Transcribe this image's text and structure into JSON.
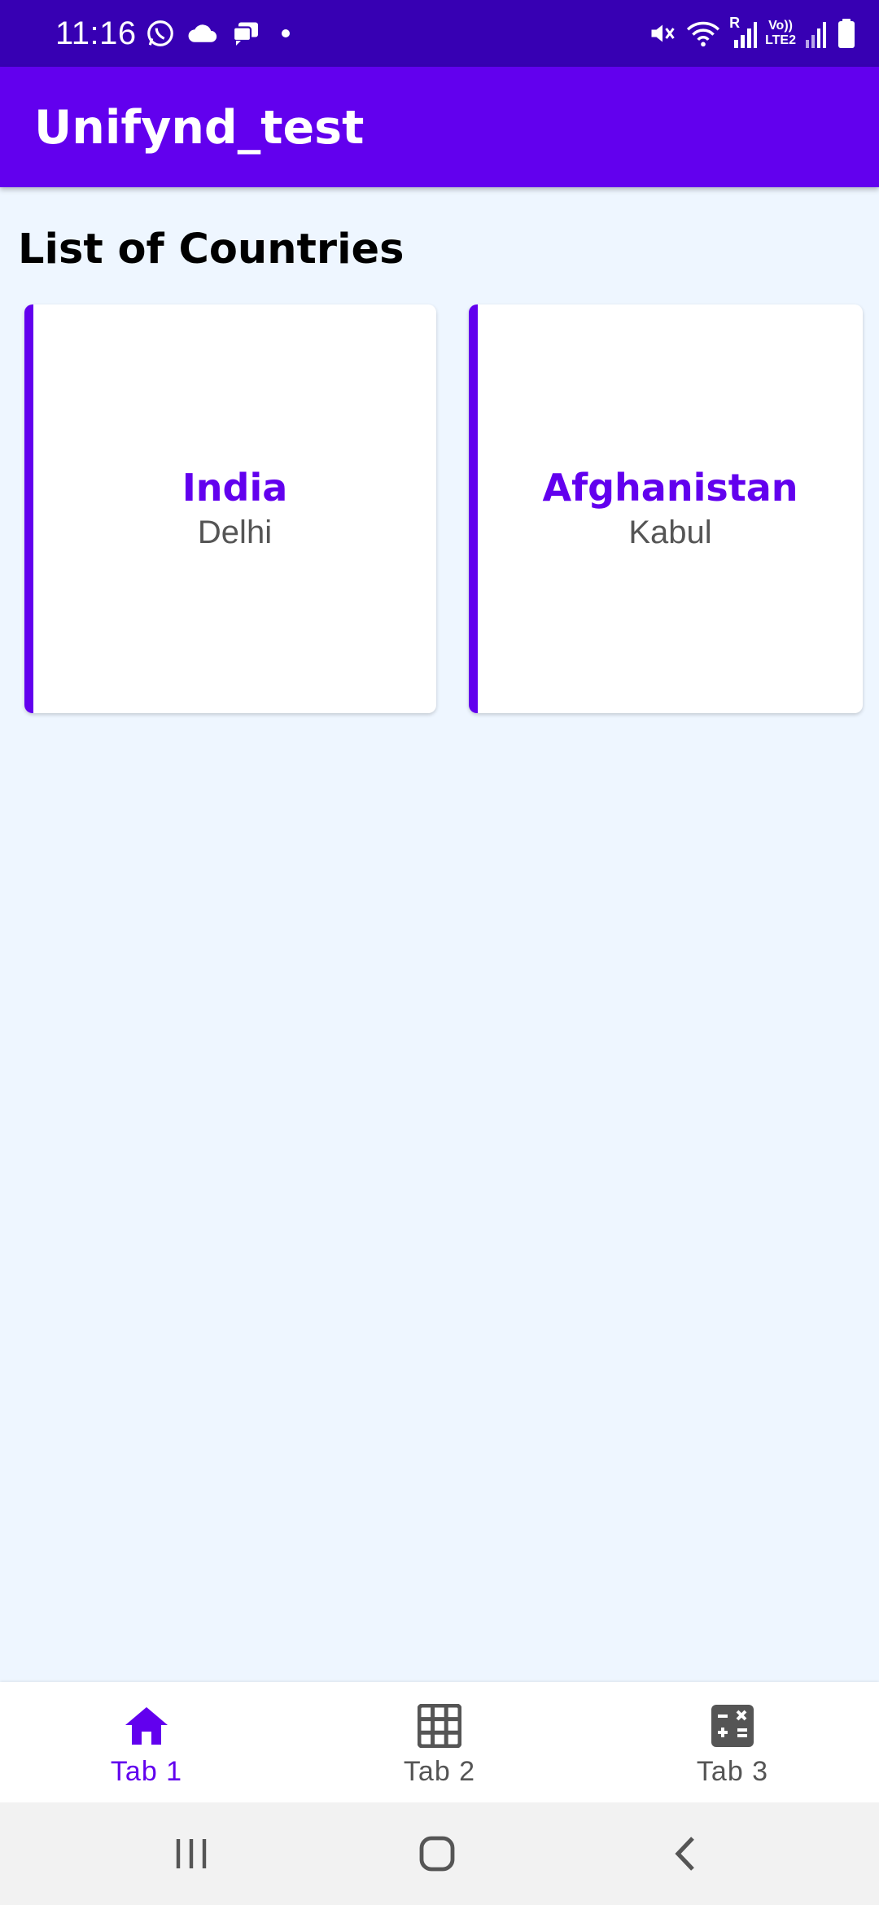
{
  "status_bar": {
    "time": "11:16",
    "left_icons": [
      "whatsapp-icon",
      "cloud-icon",
      "messages-icon",
      "dot-icon"
    ],
    "right_icons": [
      "mute-icon",
      "wifi-icon",
      "signal-r-icon",
      "volte-icon",
      "signal-icon",
      "battery-icon"
    ],
    "volte_label_top": "Vo))",
    "volte_label_bottom": "LTE2",
    "roaming_label": "R"
  },
  "app_bar": {
    "title": "Unifynd_test"
  },
  "main": {
    "section_title": "List of Countries",
    "countries": [
      {
        "name": "India",
        "capital": "Delhi"
      },
      {
        "name": "Afghanistan",
        "capital": "Kabul"
      }
    ]
  },
  "bottom_nav": {
    "tabs": [
      {
        "label": "Tab 1",
        "icon": "home-icon",
        "active": true
      },
      {
        "label": "Tab 2",
        "icon": "grid-icon",
        "active": false
      },
      {
        "label": "Tab 3",
        "icon": "calculator-icon",
        "active": false
      }
    ]
  },
  "system_nav": {
    "buttons": [
      "recent-apps-icon",
      "home-button-icon",
      "back-icon"
    ]
  },
  "colors": {
    "status_bar": "#3700b3",
    "primary": "#6200ee",
    "background": "#eef6ff",
    "card": "#ffffff",
    "capital_text": "#555555",
    "nav_inactive": "#555555"
  }
}
